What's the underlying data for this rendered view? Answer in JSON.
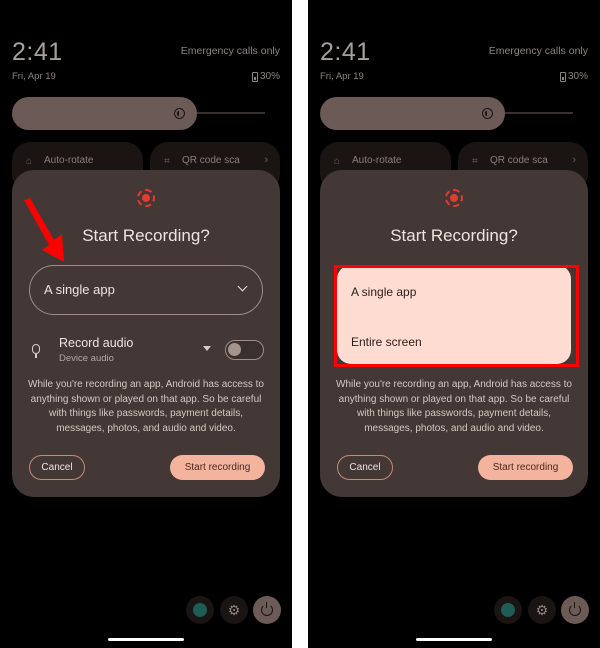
{
  "status": {
    "time": "2:41",
    "date": "Fri, Apr 19",
    "carrier_text": "Emergency calls only",
    "battery": "30%"
  },
  "brightness": {
    "level_percent": 70
  },
  "tiles": [
    {
      "label": "Auto-rotate",
      "icon": "rotate-icon"
    },
    {
      "label": "QR code sca",
      "icon": "qr-code-icon"
    }
  ],
  "dialog": {
    "title": "Start Recording?",
    "mode_selected": "A single app",
    "mode_options": [
      "A single app",
      "Entire screen"
    ],
    "audio_title": "Record audio",
    "audio_source": "Device audio",
    "audio_enabled": false,
    "warning": "While you're recording an app, Android has access to anything shown or played on that app. So be careful with things like passwords, payment details, messages, photos, and audio and video.",
    "cancel_label": "Cancel",
    "start_label": "Start recording"
  },
  "colors": {
    "accent": "#f3b39d",
    "record_red": "#e53b2e",
    "annotation_red": "#ff0000",
    "dialog_bg": "#433836",
    "menu_bg": "#ffdcd2"
  }
}
